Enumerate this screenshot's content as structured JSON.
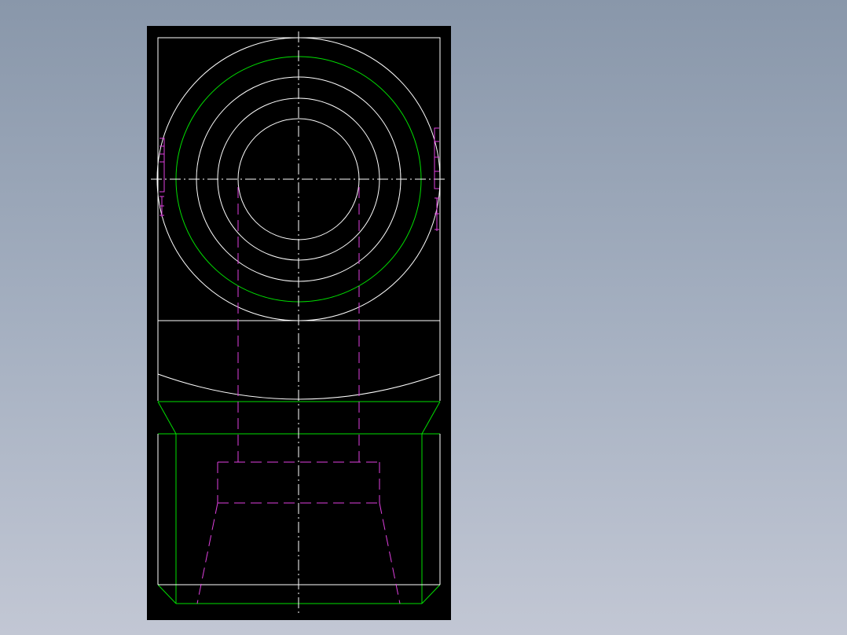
{
  "drawing": {
    "background_color": "#000000",
    "viewport_gradient": [
      "#8997aa",
      "#c2c7d4"
    ],
    "colors": {
      "outline": "#ffffff",
      "primary_geometry": "#00e000",
      "hidden_lines": "#e040e0",
      "center_lines": "#ffffff"
    }
  }
}
